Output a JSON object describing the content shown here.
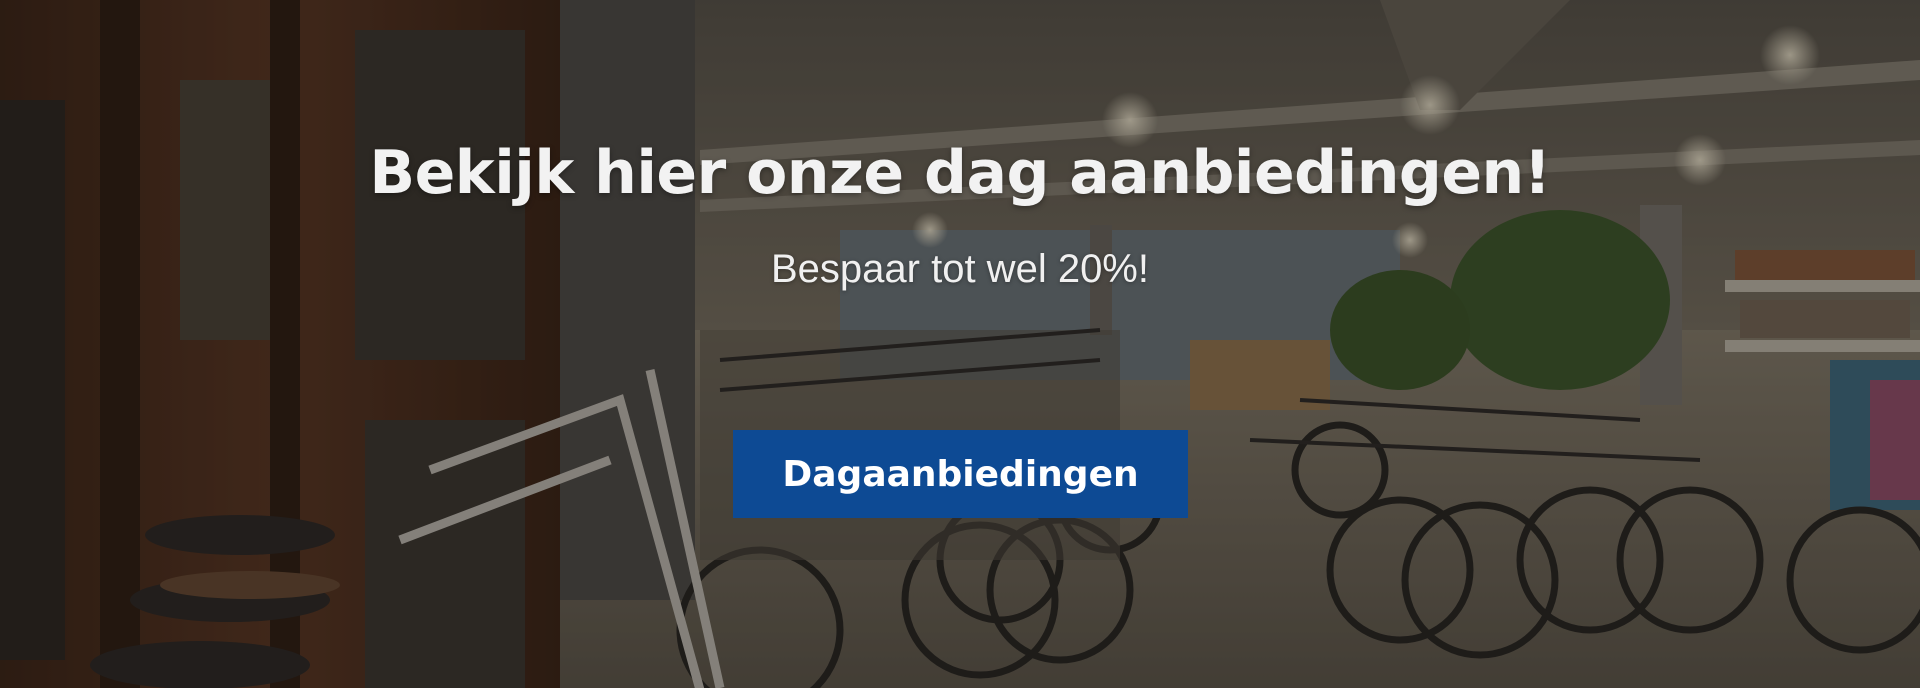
{
  "hero": {
    "headline": "Bekijk hier onze dag aanbiedingen!",
    "subline": "Bespaar tot wel 20%!",
    "cta_label": "Dagaanbiedingen",
    "cta_color": "#0d4a94",
    "background_image": "bicycle-store-interior"
  }
}
